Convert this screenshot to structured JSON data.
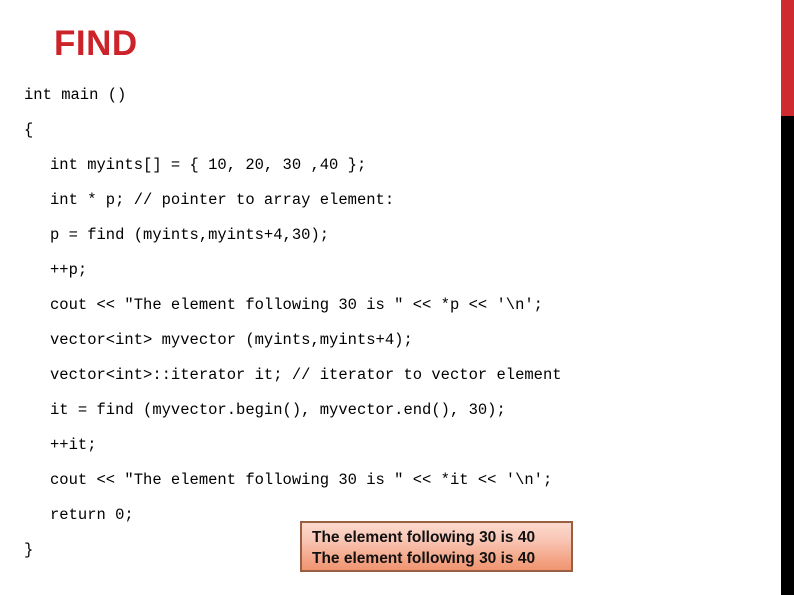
{
  "slide": {
    "title": "FIND",
    "title_color": "#cc2229"
  },
  "decor": {
    "edge_bar_red_color": "#cf2a2f",
    "edge_bar_black_color": "#000000"
  },
  "code": {
    "language": "cpp",
    "lines": [
      {
        "text": "int main ()",
        "indent": false
      },
      {
        "text": "{",
        "indent": false
      },
      {
        "text": "int myints[] = { 10, 20, 30 ,40 };",
        "indent": true
      },
      {
        "text": "int * p; // pointer to array element:",
        "indent": true
      },
      {
        "text": "p = find (myints,myints+4,30);",
        "indent": true
      },
      {
        "text": "++p;",
        "indent": true
      },
      {
        "text": "cout << \"The element following 30 is \" << *p << '\\n';",
        "indent": true
      },
      {
        "text": "vector<int> myvector (myints,myints+4);",
        "indent": true
      },
      {
        "text": "vector<int>::iterator it; // iterator to vector element",
        "indent": true
      },
      {
        "text": "it = find (myvector.begin(), myvector.end(), 30);",
        "indent": true
      },
      {
        "text": "++it;",
        "indent": true
      },
      {
        "text": "cout << \"The element following 30 is \" << *it << '\\n';",
        "indent": true
      },
      {
        "text": "return 0;",
        "indent": true
      },
      {
        "text": "}",
        "indent": false
      }
    ]
  },
  "output_box": {
    "border_color": "#9a5f43",
    "fill_top_color": "#fbd9cd",
    "fill_bottom_color": "#ef9571",
    "lines": [
      "The element following 30 is 40",
      "The element following 30 is 40"
    ]
  }
}
